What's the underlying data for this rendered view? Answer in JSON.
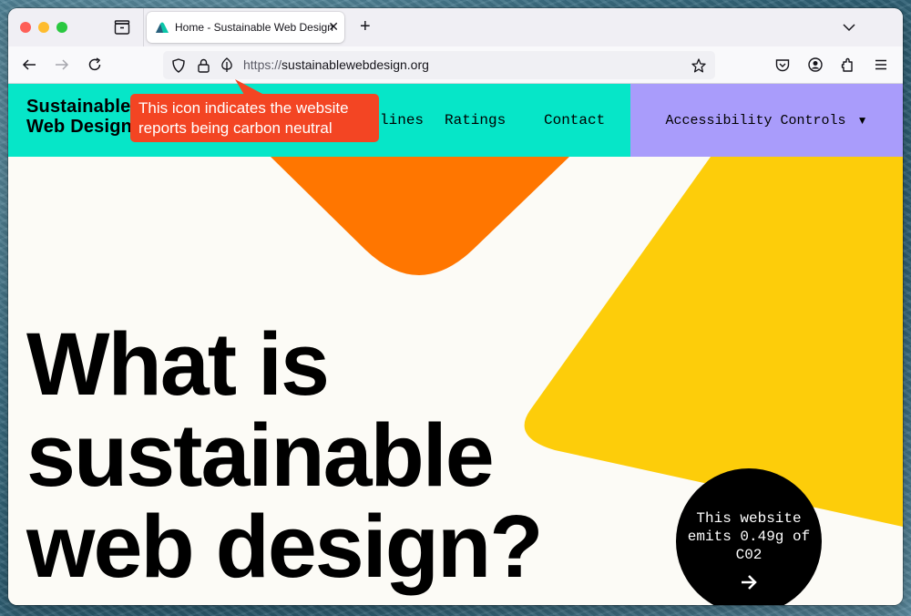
{
  "browser": {
    "tab": {
      "title": "Home - Sustainable Web Design",
      "close_icon": "close-icon"
    },
    "new_tab_label": "+",
    "url": {
      "scheme": "https://",
      "host": "sustainablewebdesign.org"
    },
    "icons": {
      "back": "arrow-left-icon",
      "forward": "arrow-right-icon",
      "reload": "reload-icon",
      "tracking_protection": "shield-icon",
      "security": "lock-icon",
      "carbon": "leaf-icon",
      "bookmark": "star-icon",
      "pocket": "pocket-icon",
      "account": "account-icon",
      "extensions": "puzzle-icon",
      "menu": "hamburger-icon"
    }
  },
  "site": {
    "logo": {
      "line1": "Sustainable",
      "line2": "Web Design"
    },
    "nav": [
      {
        "label": "Guidelines"
      },
      {
        "label": "Ratings"
      },
      {
        "label": "Contact"
      }
    ],
    "accessibility": {
      "label": "Accessibility Controls",
      "caret": "▼"
    },
    "hero": {
      "line1": "What is",
      "line2": "sustainable",
      "line3": "web design?"
    },
    "co2_badge": {
      "text": "This website emits 0.49g of C02",
      "arrow": "arrow-right-icon"
    }
  },
  "annotation": {
    "tooltip": "This icon indicates the website reports being carbon neutral"
  },
  "colors": {
    "header_teal": "#06e6c8",
    "accessibility_purple": "#a99cfb",
    "orange_shape": "#ff7600",
    "yellow_shape": "#fdcd0a",
    "tooltip_red": "#f34523",
    "page_bg": "#fcfbf6"
  }
}
